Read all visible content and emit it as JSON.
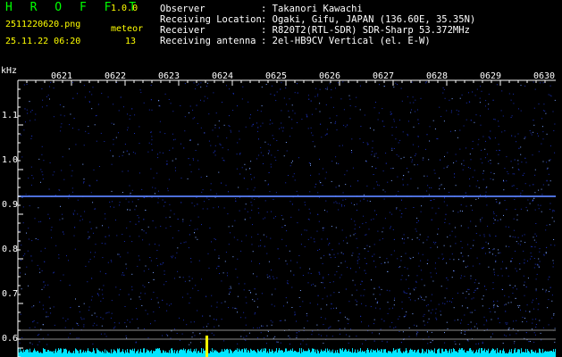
{
  "header": {
    "app_name": "H R O F F T",
    "version": "1.0.0",
    "filename": "2511220620.png",
    "datetime": "25.11.22 06:20",
    "meteor_label": "meteor",
    "meteor_count": "13",
    "info": [
      {
        "key": "Observer",
        "value": ": Takanori Kawachi"
      },
      {
        "key": "Receiving Location",
        "value": ": Ogaki, Gifu, JAPAN (136.60E, 35.35N)"
      },
      {
        "key": "Receiver",
        "value": ": R820T2(RTL-SDR) SDR-Sharp 53.372MHz"
      },
      {
        "key": "Receiving antenna",
        "value": ": 2el-HB9CV Vertical (el. E-W)"
      }
    ]
  },
  "spectrogram": {
    "y_unit": "kHz",
    "y_ticks": [
      "1.1",
      "1.0",
      "0.9",
      "0.8",
      "0.7",
      "0.6"
    ],
    "time_ticks": [
      "0621",
      "0622",
      "0623",
      "0624",
      "0625",
      "0626",
      "0627",
      "0628",
      "0629",
      "0630"
    ],
    "colors": {
      "background": "#000000",
      "noise": "#1428b4",
      "carrier": "#6496ff",
      "axis": "#ffffff",
      "baseline": "#00ffff"
    }
  }
}
